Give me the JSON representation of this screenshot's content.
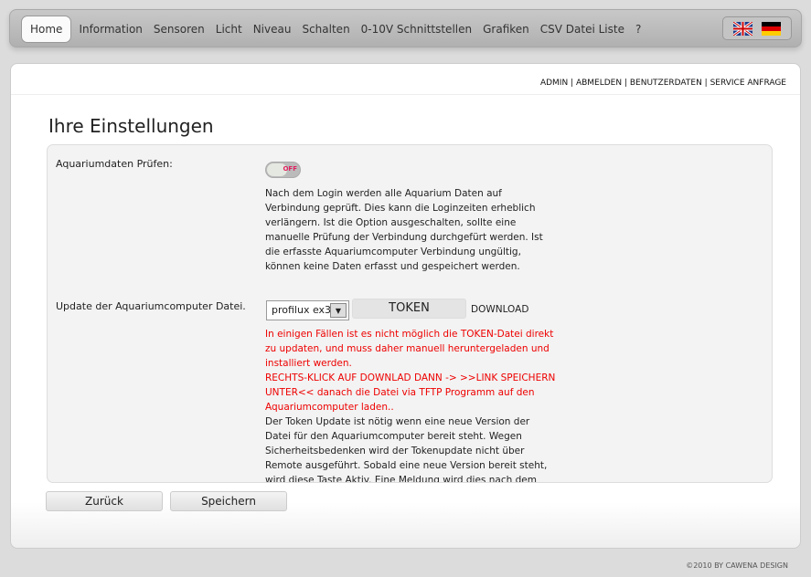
{
  "nav": {
    "items": [
      "Home",
      "Information",
      "Sensoren",
      "Licht",
      "Niveau",
      "Schalten",
      "0-10V Schnittstellen",
      "Grafiken",
      "CSV Datei Liste",
      "?"
    ],
    "active": "Home"
  },
  "flags": [
    "english-flag",
    "german-flag"
  ],
  "topnav": {
    "admin": "ADMIN",
    "logout": "ABMELDEN",
    "userdata": "BENUTZERDATEN",
    "service": "SERVICE ANFRAGE",
    "sep": " | "
  },
  "title": "Ihre Einstellungen",
  "check": {
    "label": "Aquariumdaten Prüfen:",
    "toggle": "OFF",
    "toggle_on": false,
    "desc": "Nach dem Login werden alle Aquarium Daten auf Verbindung geprüft. Dies kann die Loginzeiten erheblich verlängern. Ist die Option ausgeschalten, sollte eine manuelle Prüfung der Verbindung durchgefürt werden. Ist die erfasste Aquariumcomputer Verbindung ungültig, können keine Daten erfasst und gespeichert werden."
  },
  "update": {
    "label": "Update der Aquariumcomputer Datei.",
    "select": "profilux ex3",
    "token": "TOKEN",
    "download": "DOWNLOAD",
    "warn1": "In einigen Fällen ist es nicht möglich die TOKEN-Datei direkt zu updaten, und muss daher manuell heruntergeladen und installiert werden.",
    "warn2": "RECHTS-KLICK AUF DOWNLAD DANN -> >>LINK SPEICHERN UNTER<< danach die Datei via TFTP Programm auf den Aquariumcomputer laden..",
    "info": "Der Token Update ist nötig wenn eine neue Version der Datei für den Aquariumcomputer bereit steht. Wegen Sicherheitsbedenken wird der Tokenupdate nicht über Remote ausgeführt. Sobald eine neue Version bereit steht, wird diese Taste Aktiv. Eine Meldung wird dies nach dem Login anzeigen."
  },
  "buttons": {
    "back": "Zurück",
    "save": "Speichern"
  },
  "footer": "©2010 BY CAWENA DESIGN"
}
